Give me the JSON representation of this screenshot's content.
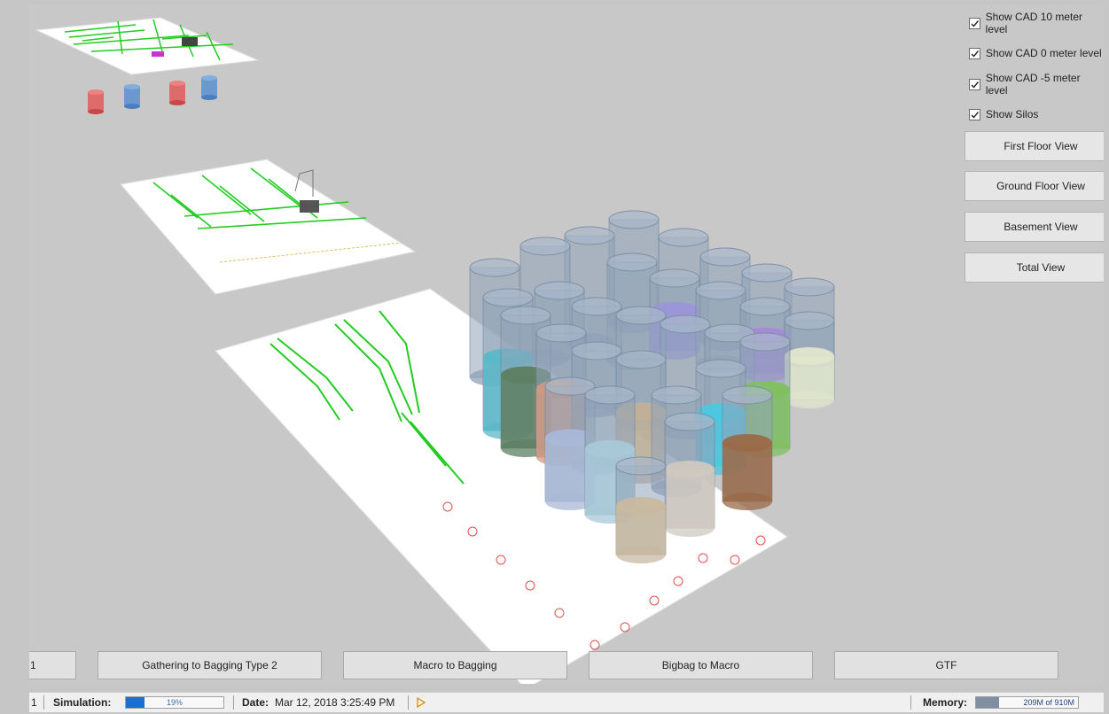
{
  "options": [
    {
      "label": "Show CAD 10 meter level",
      "checked": true
    },
    {
      "label": "Show CAD 0 meter level",
      "checked": true
    },
    {
      "label": "Show CAD -5 meter level",
      "checked": true
    },
    {
      "label": "Show Silos",
      "checked": true
    }
  ],
  "view_buttons": [
    "First Floor View",
    "Ground Floor View",
    "Basement View",
    "Total View"
  ],
  "bottom_buttons": [
    "1",
    "Gathering to Bagging Type 2",
    "Macro to Bagging",
    "Bigbag to Macro",
    "GTF"
  ],
  "status": {
    "left_index": "1",
    "simulation_label": "Simulation:",
    "simulation_progress": 0.19,
    "simulation_text": "19%",
    "date_label": "Date:",
    "date_value": "Mar 12, 2018 3:25:49 PM",
    "memory_label": "Memory:",
    "memory_text": "209M of 910M",
    "memory_fraction": 0.23
  },
  "colors": {
    "silo_glass": "#8fa2b8",
    "cad_lines": "#22cc22",
    "marker_red": "#e05050",
    "progress_fill": "#1a6fd0"
  }
}
